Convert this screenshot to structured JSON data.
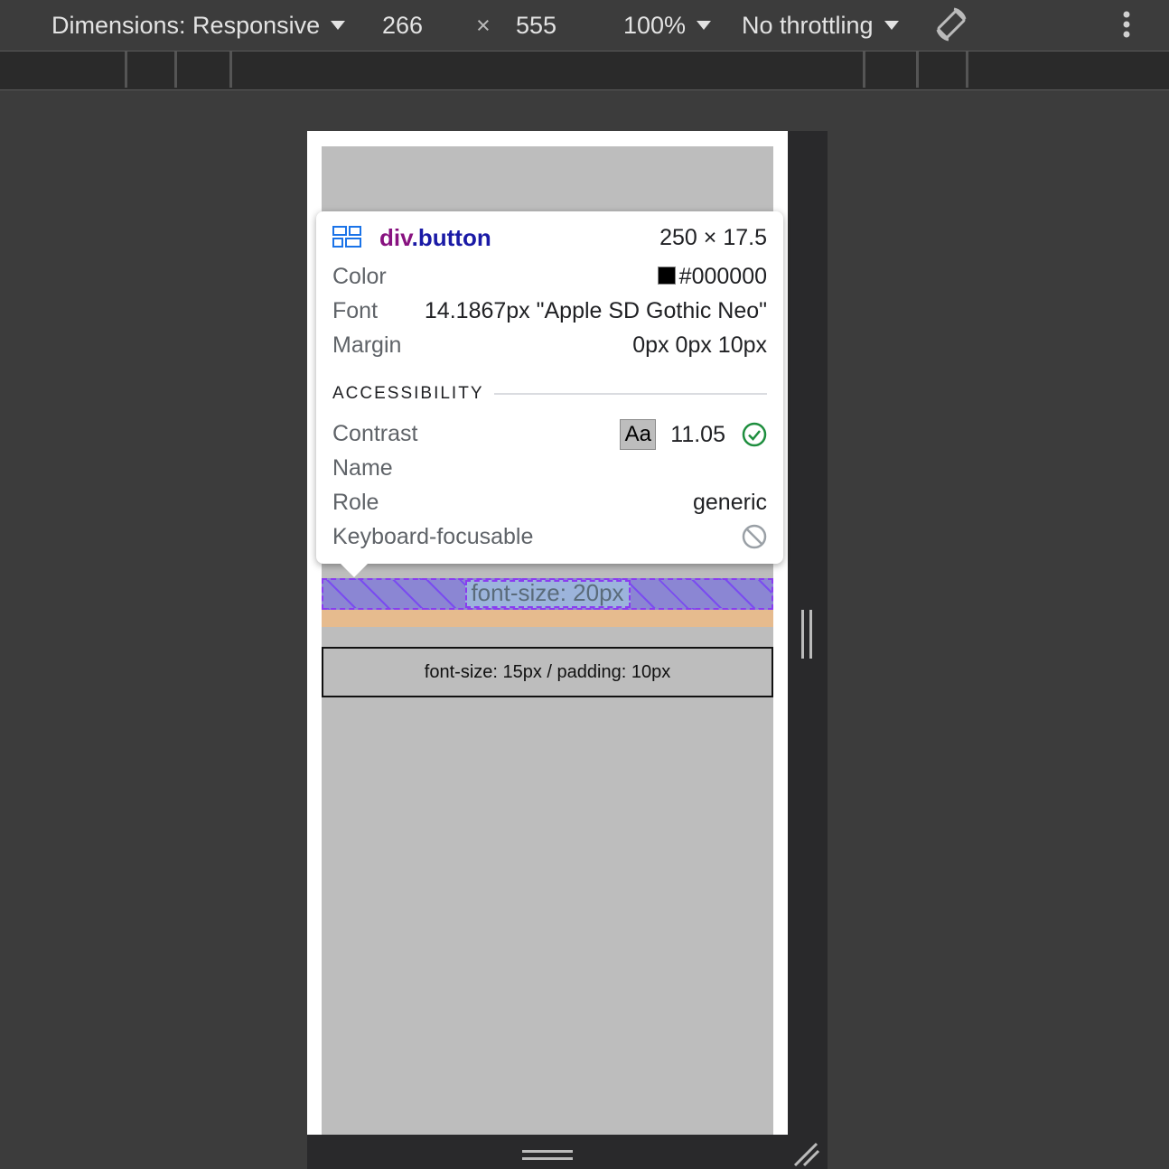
{
  "toolbar": {
    "dimensions_label": "Dimensions: Responsive",
    "width": "266",
    "times": "×",
    "height": "555",
    "zoom": "100%",
    "throttling": "No throttling",
    "rotate_icon": "rotate-icon",
    "more_icon": "more-vertical-icon"
  },
  "page": {
    "button_text": "font-size: 20px",
    "button2_text": "font-size: 15px / padding: 10px"
  },
  "tooltip": {
    "element_tag": "div",
    "element_class": ".button",
    "size": "250 × 17.5",
    "color_label": "Color",
    "color_value": "#000000",
    "font_label": "Font",
    "font_value": "14.1867px \"Apple SD Gothic Neo\"",
    "margin_label": "Margin",
    "margin_value": "0px 0px 10px",
    "section_title": "ACCESSIBILITY",
    "contrast_label": "Contrast",
    "contrast_sample": "Aa",
    "contrast_value": "11.05",
    "name_label": "Name",
    "role_label": "Role",
    "role_value": "generic",
    "focusable_label": "Keyboard-focusable",
    "colors": {
      "tag": "#881280",
      "class": "#1a1aa6",
      "ok": "#1e8e3e"
    }
  }
}
